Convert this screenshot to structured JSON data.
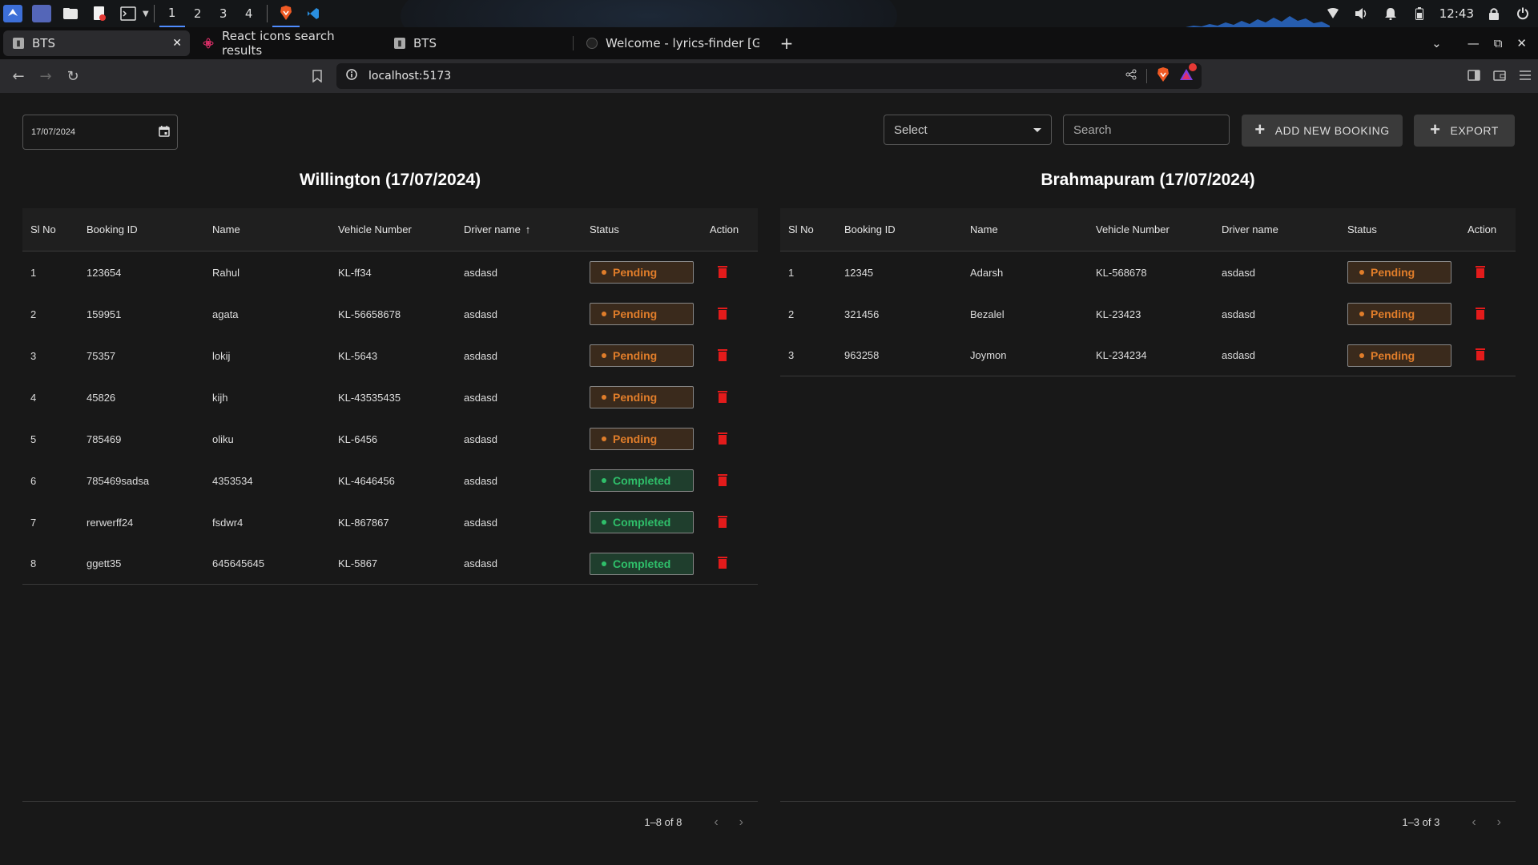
{
  "taskbar": {
    "workspaces": [
      "1",
      "2",
      "3",
      "4"
    ],
    "active_workspace": "1",
    "clock": "12:43"
  },
  "browser": {
    "tabs": [
      {
        "title": "BTS",
        "active": true
      },
      {
        "title": "React icons search results",
        "active": false
      },
      {
        "title": "BTS",
        "active": false
      },
      {
        "title": "Welcome - lyrics-finder [Gith",
        "active": false
      }
    ],
    "url": "localhost:5173",
    "colors": {
      "brave": "#f05a24",
      "accent": "#4f8cff"
    }
  },
  "toolbar": {
    "date_value": "17/07/2024",
    "select_label": "Select",
    "search_placeholder": "Search",
    "add_label": "ADD NEW BOOKING",
    "export_label": "EXPORT"
  },
  "columns": {
    "sl": "Sl No",
    "booking_id": "Booking ID",
    "name": "Name",
    "vehicle": "Vehicle Number",
    "driver": "Driver name",
    "status": "Status",
    "action": "Action"
  },
  "left": {
    "title": "Willington (17/07/2024)",
    "sorted_column": "driver",
    "rows": [
      {
        "sl": "1",
        "id": "123654",
        "name": "Rahul",
        "vehicle": "KL-ff34",
        "driver": "asdasd",
        "status": "Pending"
      },
      {
        "sl": "2",
        "id": "159951",
        "name": "agata",
        "vehicle": "KL-56658678",
        "driver": "asdasd",
        "status": "Pending"
      },
      {
        "sl": "3",
        "id": "75357",
        "name": "lokij",
        "vehicle": "KL-5643",
        "driver": "asdasd",
        "status": "Pending"
      },
      {
        "sl": "4",
        "id": "45826",
        "name": "kijh",
        "vehicle": "KL-43535435",
        "driver": "asdasd",
        "status": "Pending"
      },
      {
        "sl": "5",
        "id": "785469",
        "name": "oliku",
        "vehicle": "KL-6456",
        "driver": "asdasd",
        "status": "Pending"
      },
      {
        "sl": "6",
        "id": "785469sadsa",
        "name": "4353534",
        "vehicle": "KL-4646456",
        "driver": "asdasd",
        "status": "Completed"
      },
      {
        "sl": "7",
        "id": "rerwerff24",
        "name": "fsdwr4",
        "vehicle": "KL-867867",
        "driver": "asdasd",
        "status": "Completed"
      },
      {
        "sl": "8",
        "id": "ggett35",
        "name": "645645645",
        "vehicle": "KL-5867",
        "driver": "asdasd",
        "status": "Completed"
      }
    ],
    "pagination": "1–8 of 8"
  },
  "right": {
    "title": "Brahmapuram (17/07/2024)",
    "rows": [
      {
        "sl": "1",
        "id": "12345",
        "name": "Adarsh",
        "vehicle": "KL-568678",
        "driver": "asdasd",
        "status": "Pending"
      },
      {
        "sl": "2",
        "id": "321456",
        "name": "Bezalel",
        "vehicle": "KL-23423",
        "driver": "asdasd",
        "status": "Pending"
      },
      {
        "sl": "3",
        "id": "963258",
        "name": "Joymon",
        "vehicle": "KL-234234",
        "driver": "asdasd",
        "status": "Pending"
      }
    ],
    "pagination": "1–3 of 3"
  },
  "status_colors": {
    "Pending": "#e07d2a",
    "Completed": "#2fbf6a",
    "delete": "#e31b1b"
  }
}
